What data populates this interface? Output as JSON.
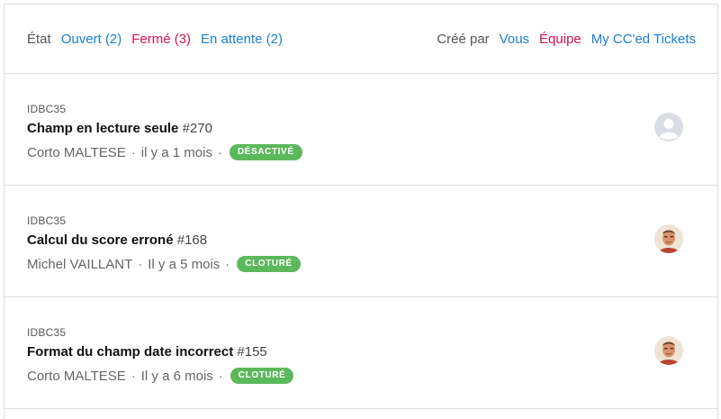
{
  "filters": {
    "state_label": "État",
    "open": "Ouvert (2)",
    "closed": "Fermé (3)",
    "pending": "En attente (2)",
    "created_by_label": "Créé par",
    "you": "Vous",
    "team": "Équipe",
    "cc": "My CC'ed Tickets"
  },
  "tickets": [
    {
      "project": "IDBC35",
      "title": "Champ en lecture seule",
      "number": "#270",
      "author": "Corto MALTESE",
      "time": "il y a 1 mois",
      "status": "DÉSACTIVÉ",
      "avatar": "default-avatar-icon"
    },
    {
      "project": "IDBC35",
      "title": "Calcul du score erroné",
      "number": "#168",
      "author": "Michel VAILLANT",
      "time": "Il y a 5 mois",
      "status": "CLOTURÉ",
      "avatar": "user-photo"
    },
    {
      "project": "IDBC35",
      "title": "Format du champ date incorrect",
      "number": "#155",
      "author": "Corto MALTESE",
      "time": "Il y a 6 mois",
      "status": "CLOTURÉ",
      "avatar": "user-photo"
    }
  ],
  "colors": {
    "link": "#1a7fd0",
    "active_filter": "#d6154f",
    "badge": "#5cb85c"
  }
}
